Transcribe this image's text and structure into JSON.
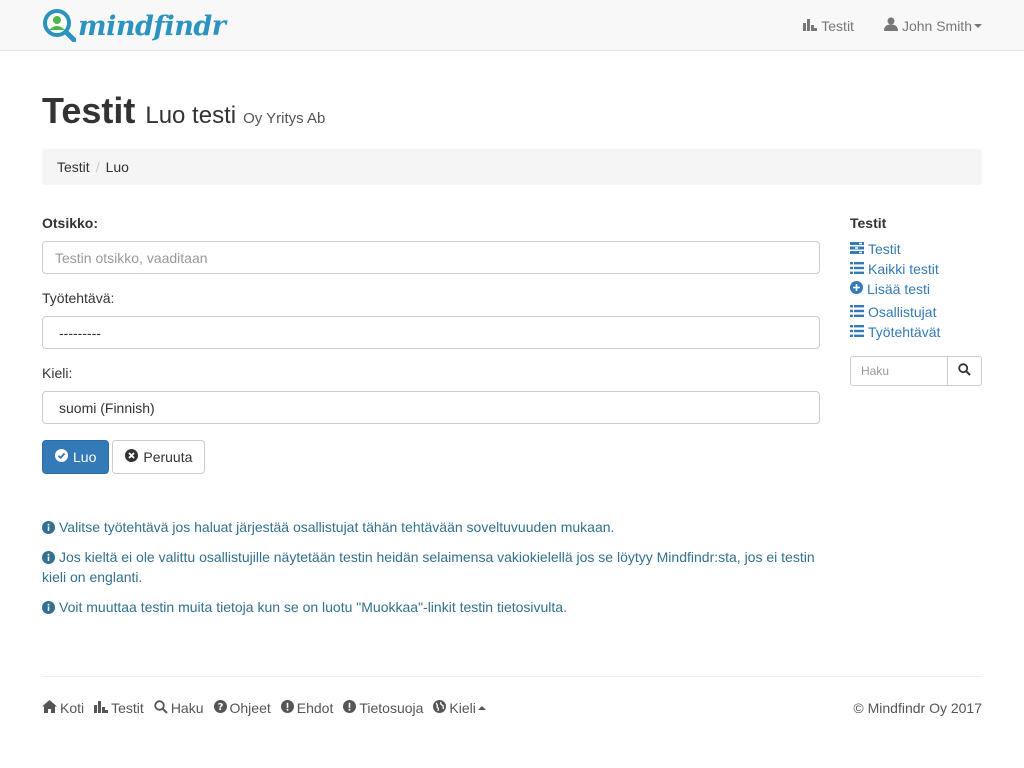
{
  "navbar": {
    "brand": "mindfindr",
    "tests_link": "Testit",
    "user_name": "John Smith"
  },
  "header": {
    "title": "Testit",
    "subtitle": "Luo testi",
    "company": "Oy Yritys Ab"
  },
  "breadcrumb": {
    "items": [
      "Testit",
      "Luo"
    ]
  },
  "form": {
    "title_label": "Otsikko:",
    "title_placeholder": "Testin otsikko, vaaditaan",
    "job_label": "Työtehtävä:",
    "job_value": "---------",
    "language_label": "Kieli:",
    "language_value": "suomi (Finnish)",
    "create_button": "Luo",
    "cancel_button": "Peruuta"
  },
  "help": [
    "Valitse työtehtävä jos haluat järjestää osallistujat tähän tehtävään soveltuvuuden mukaan.",
    "Jos kieltä ei ole valittu osallistujille näytetään testin heidän selaimensa vakiokielellä jos se löytyy Mindfindr:sta, jos ei testin kieli on englanti.",
    "Voit muuttaa testin muita tietoja kun se on luotu \"Muokkaa\"-linkit testin tietosivulta."
  ],
  "sidebar": {
    "title": "Testit",
    "items": [
      {
        "label": "Testit",
        "icon": "tasks-icon"
      },
      {
        "label": "Kaikki testit",
        "icon": "list-icon"
      },
      {
        "label": "Lisää testi",
        "icon": "plus-circle-icon"
      },
      {
        "label": "Osallistujat",
        "icon": "list-icon"
      },
      {
        "label": "Työtehtävät",
        "icon": "list-icon"
      }
    ],
    "search_placeholder": "Haku"
  },
  "footer": {
    "links": [
      "Koti",
      "Testit",
      "Haku",
      "Ohjeet",
      "Ehdot",
      "Tietosuoja",
      "Kieli"
    ],
    "copyright": "© Mindfindr Oy 2017"
  },
  "colors": {
    "link": "#337ab7",
    "primary": "#337ab7",
    "help_text": "#31708f",
    "brand": "#2b93bf"
  }
}
